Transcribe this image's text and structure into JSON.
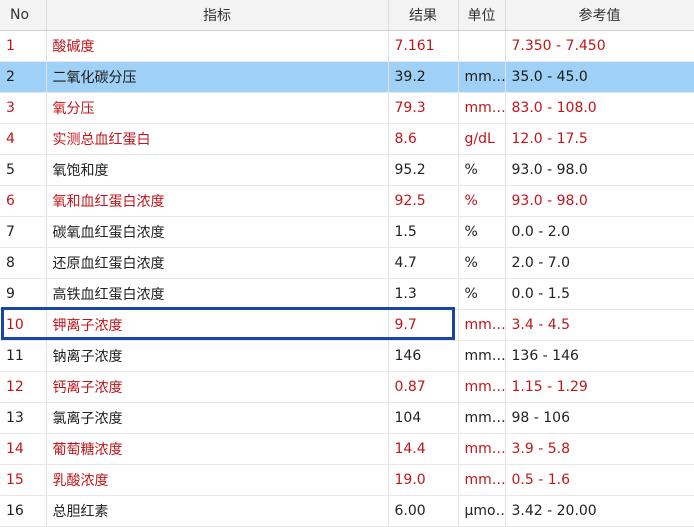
{
  "headers": {
    "no": "No",
    "indicator": "指标",
    "result": "结果",
    "unit": "单位",
    "reference": "参考值"
  },
  "rows": [
    {
      "no": "1",
      "name": "酸碱度",
      "result": "7.161",
      "unit": "",
      "ref": "7.350 - 7.450",
      "abnormal": true,
      "selected": false
    },
    {
      "no": "2",
      "name": "二氧化碳分压",
      "result": "39.2",
      "unit": "mm…",
      "ref": "35.0 - 45.0",
      "abnormal": false,
      "selected": true
    },
    {
      "no": "3",
      "name": "氧分压",
      "result": "79.3",
      "unit": "mm…",
      "ref": "83.0 - 108.0",
      "abnormal": true,
      "selected": false
    },
    {
      "no": "4",
      "name": "实测总血红蛋白",
      "result": "8.6",
      "unit": "g/dL",
      "ref": "12.0 - 17.5",
      "abnormal": true,
      "selected": false
    },
    {
      "no": "5",
      "name": "氧饱和度",
      "result": "95.2",
      "unit": "%",
      "ref": "93.0 - 98.0",
      "abnormal": false,
      "selected": false
    },
    {
      "no": "6",
      "name": "氧和血红蛋白浓度",
      "result": "92.5",
      "unit": "%",
      "ref": "93.0 - 98.0",
      "abnormal": true,
      "selected": false
    },
    {
      "no": "7",
      "name": "碳氧血红蛋白浓度",
      "result": "1.5",
      "unit": "%",
      "ref": "0.0 - 2.0",
      "abnormal": false,
      "selected": false
    },
    {
      "no": "8",
      "name": "还原血红蛋白浓度",
      "result": "4.7",
      "unit": "%",
      "ref": "2.0 - 7.0",
      "abnormal": false,
      "selected": false
    },
    {
      "no": "9",
      "name": "高铁血红蛋白浓度",
      "result": "1.3",
      "unit": "%",
      "ref": "0.0 - 1.5",
      "abnormal": false,
      "selected": false
    },
    {
      "no": "10",
      "name": "钾离子浓度",
      "result": "9.7",
      "unit": "mm…",
      "ref": "3.4 - 4.5",
      "abnormal": true,
      "selected": false
    },
    {
      "no": "11",
      "name": "钠离子浓度",
      "result": "146",
      "unit": "mm…",
      "ref": "136 - 146",
      "abnormal": false,
      "selected": false
    },
    {
      "no": "12",
      "name": "钙离子浓度",
      "result": "0.87",
      "unit": "mm…",
      "ref": "1.15 - 1.29",
      "abnormal": true,
      "selected": false
    },
    {
      "no": "13",
      "name": "氯离子浓度",
      "result": "104",
      "unit": "mm…",
      "ref": "98 - 106",
      "abnormal": false,
      "selected": false
    },
    {
      "no": "14",
      "name": "葡萄糖浓度",
      "result": "14.4",
      "unit": "mm…",
      "ref": "3.9 - 5.8",
      "abnormal": true,
      "selected": false
    },
    {
      "no": "15",
      "name": "乳酸浓度",
      "result": "19.0",
      "unit": "mm…",
      "ref": "0.5 - 1.6",
      "abnormal": true,
      "selected": false
    },
    {
      "no": "16",
      "name": "总胆红素",
      "result": "6.00",
      "unit": "μmo…",
      "ref": "3.42 - 20.00",
      "abnormal": false,
      "selected": false
    }
  ],
  "colors": {
    "abnormal_text": "#c0161b",
    "selected_row": "#9fd0f6",
    "highlight_box": "#1745a8"
  }
}
